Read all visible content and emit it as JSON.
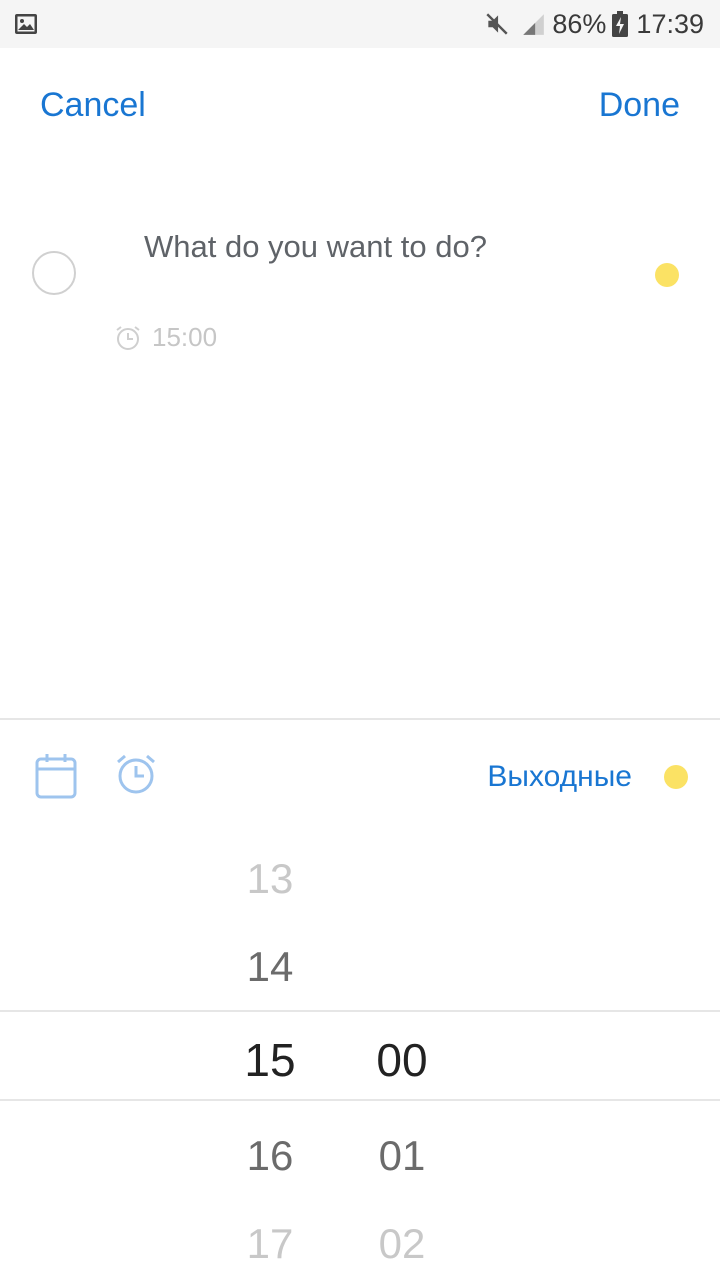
{
  "status_bar": {
    "battery_percent": "86%",
    "time": "17:39"
  },
  "header": {
    "cancel_label": "Cancel",
    "done_label": "Done"
  },
  "task": {
    "placeholder": "What do you want to do?",
    "alarm_time": "15:00",
    "accent_color": "#fbe264"
  },
  "toolbar": {
    "list_label": "Выходные",
    "icons": [
      "calendar-icon",
      "alarm-icon"
    ]
  },
  "time_picker": {
    "hours": [
      "13",
      "14",
      "15",
      "16",
      "17"
    ],
    "minutes": [
      "00",
      "01",
      "02"
    ],
    "selected_hour": "15",
    "selected_minute": "00"
  },
  "colors": {
    "accent": "#1976d2",
    "list_dot": "#fbe264"
  }
}
